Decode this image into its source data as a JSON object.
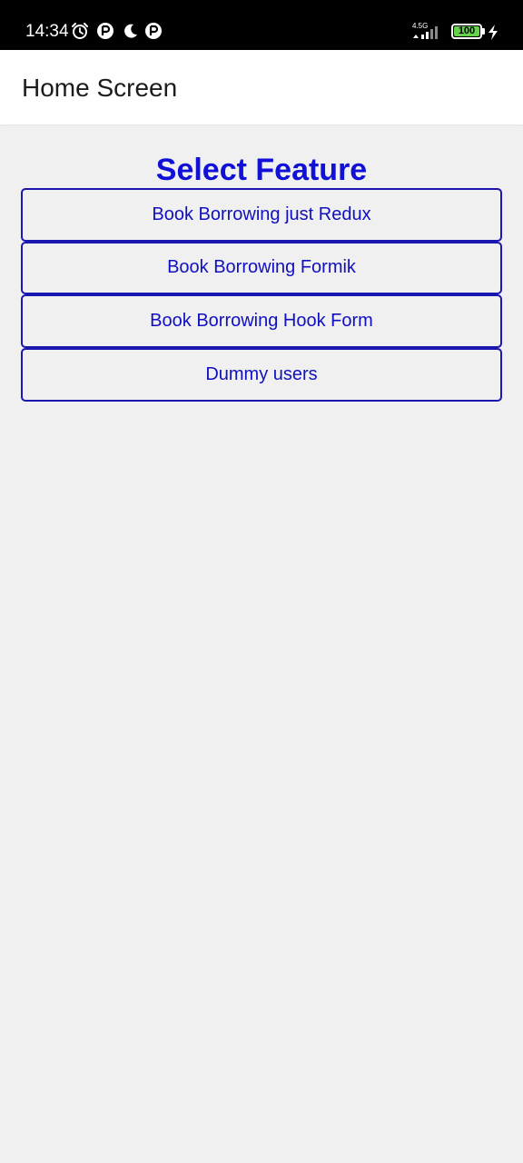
{
  "status_bar": {
    "time": "14:34",
    "network_label": "4.5G",
    "battery_level": "100",
    "battery_percent": 100,
    "icons": [
      "alarm-icon",
      "app-notification-icon",
      "moon-icon",
      "app-notification-icon",
      "signal-icon",
      "battery-icon",
      "charging-icon"
    ]
  },
  "header": {
    "title": "Home Screen"
  },
  "main": {
    "section_title": "Select Feature",
    "buttons": [
      {
        "label": "Book Borrowing just Redux"
      },
      {
        "label": "Book Borrowing Formik"
      },
      {
        "label": "Book Borrowing Hook Form"
      },
      {
        "label": "Dummy users"
      }
    ]
  },
  "colors": {
    "accent": "#1010d6",
    "button_border": "#1a16b0",
    "background": "#f0f0f0",
    "header_bg": "#ffffff",
    "status_bar_bg": "#000000",
    "battery_fill": "#64d24b"
  }
}
